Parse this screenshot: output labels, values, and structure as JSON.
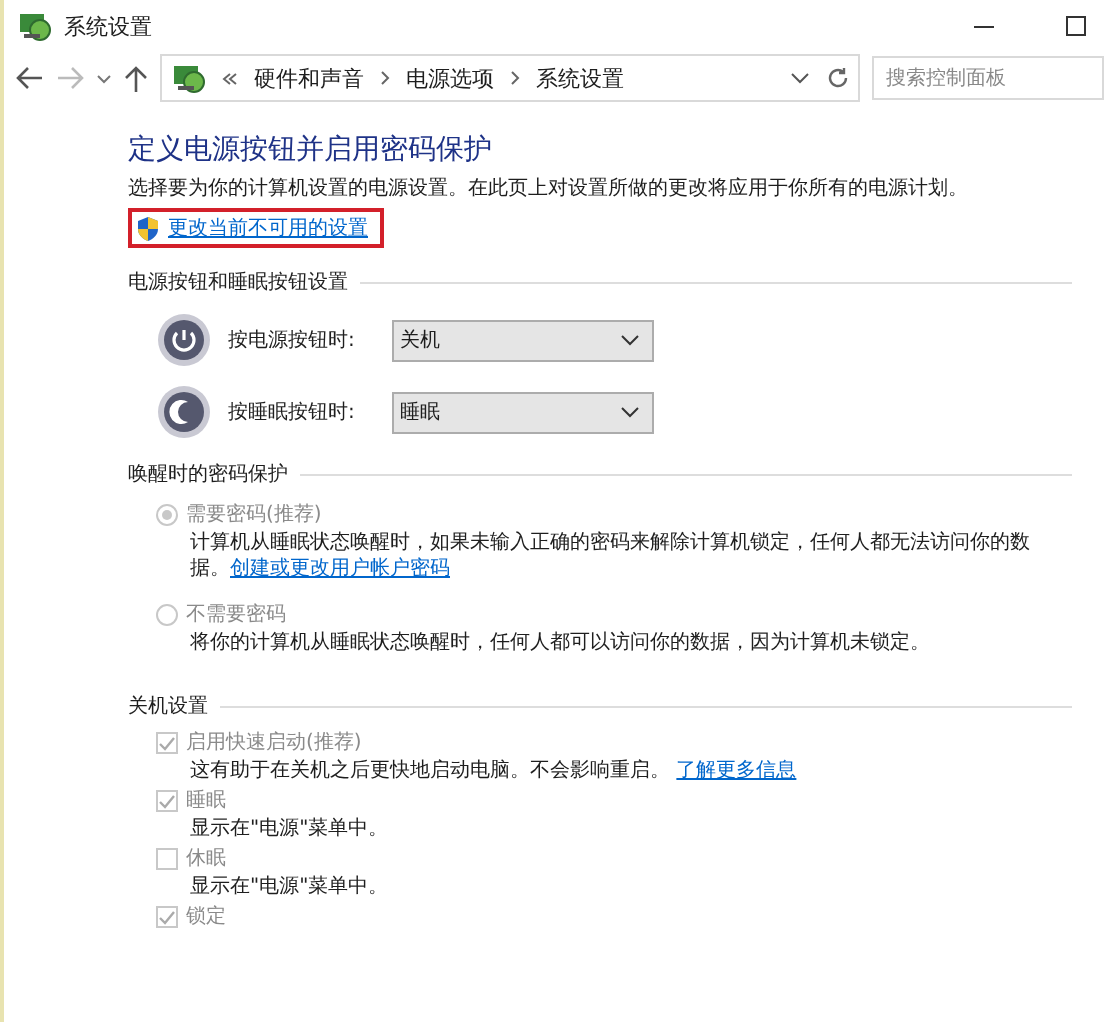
{
  "window": {
    "title": "系统设置"
  },
  "nav": {
    "breadcrumb": [
      "硬件和声音",
      "电源选项",
      "系统设置"
    ],
    "search": {
      "placeholder": "搜索控制面板"
    }
  },
  "heading": "定义电源按钮并启用密码保护",
  "description": "选择要为你的计算机设置的电源设置。在此页上对设置所做的更改将应用于你所有的电源计划。",
  "admin_link": {
    "label": "更改当前不可用的设置",
    "highlighted": true
  },
  "button_section": {
    "title": "电源按钮和睡眠按钮设置",
    "rows": [
      {
        "kind": "power",
        "label": "按电源按钮时:",
        "value": "关机"
      },
      {
        "kind": "sleep",
        "label": "按睡眠按钮时:",
        "value": "睡眠"
      }
    ]
  },
  "password_section": {
    "title": "唤醒时的密码保护",
    "options": [
      {
        "label": "需要密码(推荐)",
        "selected": true,
        "disabled": true,
        "description": "计算机从睡眠状态唤醒时，如果未输入正确的密码来解除计算机锁定，任何人都无法访问你的数据。",
        "link": "创建或更改用户帐户密码"
      },
      {
        "label": "不需要密码",
        "selected": false,
        "disabled": true,
        "description": "将你的计算机从睡眠状态唤醒时，任何人都可以访问你的数据，因为计算机未锁定。"
      }
    ]
  },
  "shutdown_section": {
    "title": "关机设置",
    "options": [
      {
        "label": "启用快速启动(推荐)",
        "checked": true,
        "disabled": true,
        "description": "这有助于在关机之后更快地启动电脑。不会影响重启。",
        "link": "了解更多信息"
      },
      {
        "label": "睡眠",
        "checked": true,
        "disabled": true,
        "description": "显示在\"电源\"菜单中。"
      },
      {
        "label": "休眠",
        "checked": false,
        "disabled": true,
        "description": "显示在\"电源\"菜单中。"
      },
      {
        "label": "锁定",
        "checked": true,
        "disabled": true
      }
    ]
  }
}
